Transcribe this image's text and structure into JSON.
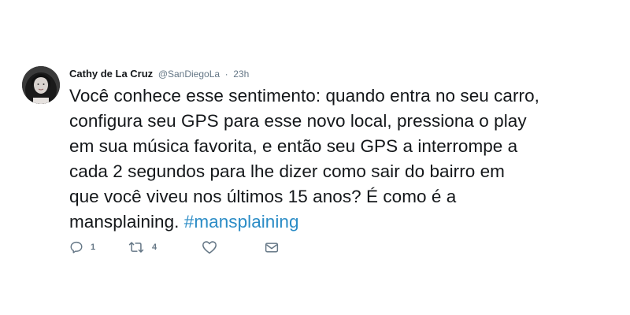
{
  "tweet": {
    "author_name": "Cathy de La Cruz",
    "author_handle": "@SanDiegoLa",
    "separator": "·",
    "timestamp": "23h",
    "lines": [
      "Você conhece esse sentimento: quando entra no seu carro,",
      "configura seu GPS para esse novo local, pressiona o play",
      "em sua música favorita, e então seu GPS a interrompe a",
      "cada 2 segundos para lhe dizer como sair do bairro em",
      "que você viveu nos últimos 15 anos? É como é a"
    ],
    "last_line_text": "mansplaining.",
    "hashtag": "#mansplaining"
  },
  "actions": {
    "reply_icon": "reply-icon",
    "reply_count": "1",
    "retweet_icon": "retweet-icon",
    "retweet_count": "4",
    "like_icon": "heart-icon",
    "dm_icon": "envelope-icon"
  },
  "colors": {
    "text": "#14171a",
    "muted": "#657786",
    "link": "#2b8cc6",
    "background": "#ffffff"
  }
}
